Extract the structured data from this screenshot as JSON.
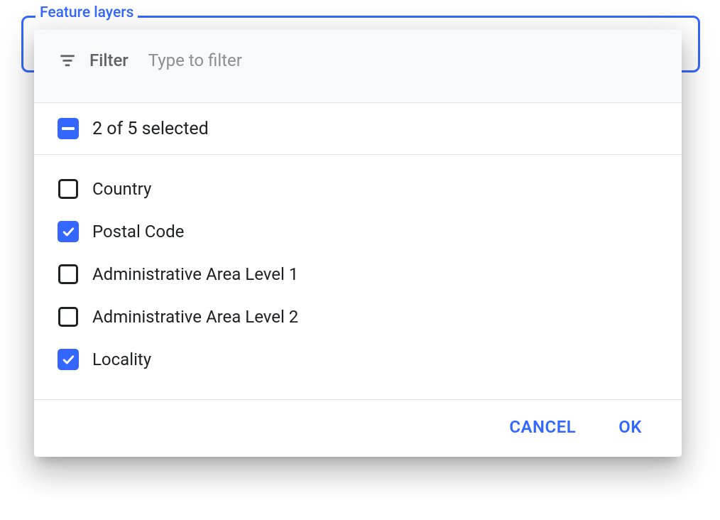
{
  "fieldset": {
    "legend": "Feature layers"
  },
  "filter": {
    "label": "Filter",
    "placeholder": "Type to filter",
    "value": ""
  },
  "selectAll": {
    "label": "2 of 5 selected",
    "state": "indeterminate"
  },
  "options": [
    {
      "label": "Country",
      "checked": false
    },
    {
      "label": "Postal Code",
      "checked": true
    },
    {
      "label": "Administrative Area Level 1",
      "checked": false
    },
    {
      "label": "Administrative Area Level 2",
      "checked": false
    },
    {
      "label": "Locality",
      "checked": true
    }
  ],
  "actions": {
    "cancel": "CANCEL",
    "ok": "OK"
  },
  "colors": {
    "primary": "#3367ff",
    "text": "#202124",
    "muted": "#5f6368"
  }
}
